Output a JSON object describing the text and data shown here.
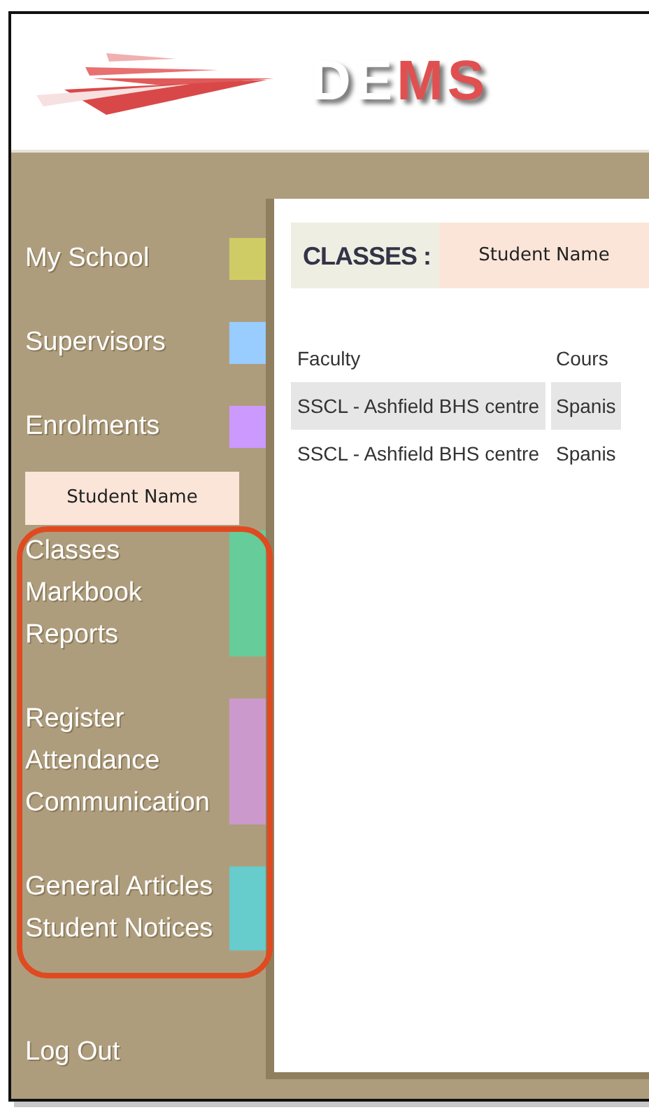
{
  "header": {
    "logo_text": "DEMS"
  },
  "sidebar": {
    "groups": [
      {
        "items": [
          "My School"
        ],
        "color": "#cfcc66",
        "highlighted": false
      },
      {
        "items": [
          "Supervisors"
        ],
        "color": "#99ccff",
        "highlighted": false
      },
      {
        "items": [
          "Enrolments"
        ],
        "color": "#cc99ff",
        "highlighted": false
      },
      {
        "kind": "name",
        "label": "Student Name"
      },
      {
        "items": [
          "Classes",
          "Markbook",
          "Reports"
        ],
        "color": "#66cc99",
        "highlighted": true
      },
      {
        "items": [
          "Register",
          "Attendance",
          "Communication"
        ],
        "color": "#cc99cc",
        "highlighted": true
      },
      {
        "items": [
          "General Articles",
          "Student Notices"
        ],
        "color": "#66cccc",
        "highlighted": true
      }
    ],
    "logout": "Log Out"
  },
  "content": {
    "title": "CLASSES :",
    "student": "Student Name",
    "table": {
      "columns": [
        "Faculty",
        "Cours"
      ],
      "rows": [
        {
          "cells": [
            "SSCL - Ashfield BHS centre",
            "Spanis"
          ],
          "selected": true
        },
        {
          "cells": [
            "SSCL - Ashfield BHS centre",
            "Spanis"
          ],
          "selected": false
        }
      ]
    }
  }
}
